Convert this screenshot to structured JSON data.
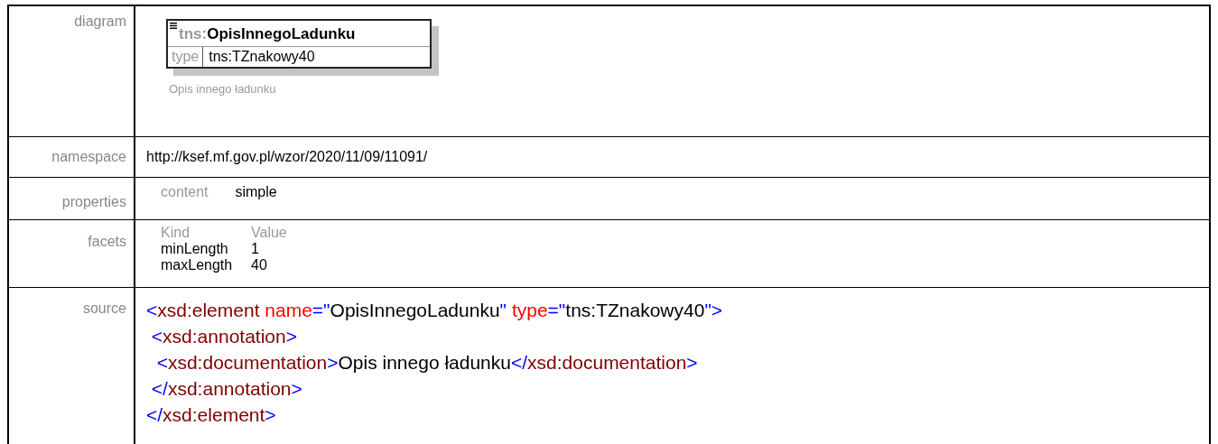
{
  "rows": [
    {
      "kind": "diagram",
      "label": "diagram",
      "diagram": {
        "prefix": "tns:",
        "name": "OpisInnegoLadunku",
        "type_label": "type",
        "type_value": "tns:TZnakowy40",
        "documentation": "Opis innego ładunku"
      }
    },
    {
      "kind": "text",
      "label": "namespace",
      "value": "http://ksef.mf.gov.pl/wzor/2020/11/09/11091/"
    },
    {
      "kind": "properties",
      "label": "properties",
      "items": [
        {
          "name": "content",
          "value": "simple"
        }
      ]
    },
    {
      "kind": "facets",
      "label": "facets",
      "columns": [
        "Kind",
        "Value"
      ],
      "items": [
        {
          "name": "minLength",
          "value": "1"
        },
        {
          "name": "maxLength",
          "value": "40"
        }
      ]
    },
    {
      "kind": "source",
      "label": "source",
      "lines": [
        [
          {
            "kind": "punct",
            "text": "<"
          },
          {
            "kind": "tag",
            "text": "xsd:element "
          },
          {
            "kind": "attr",
            "text": "name"
          },
          {
            "kind": "punct",
            "text": "=\""
          },
          {
            "kind": "text",
            "text": "OpisInnegoLadunku"
          },
          {
            "kind": "punct",
            "text": "\" "
          },
          {
            "kind": "attr",
            "text": "type"
          },
          {
            "kind": "punct",
            "text": "=\""
          },
          {
            "kind": "text",
            "text": "tns:TZnakowy40"
          },
          {
            "kind": "punct",
            "text": "\">"
          }
        ],
        [
          {
            "kind": "punct",
            "text": " <"
          },
          {
            "kind": "tag",
            "text": "xsd:annotation"
          },
          {
            "kind": "punct",
            "text": ">"
          }
        ],
        [
          {
            "kind": "punct",
            "text": "  <"
          },
          {
            "kind": "tag",
            "text": "xsd:documentation"
          },
          {
            "kind": "punct",
            "text": ">"
          },
          {
            "kind": "text",
            "text": "Opis innego ładunku"
          },
          {
            "kind": "punct",
            "text": "</"
          },
          {
            "kind": "tag",
            "text": "xsd:documentation"
          },
          {
            "kind": "punct",
            "text": ">"
          }
        ],
        [
          {
            "kind": "punct",
            "text": " </"
          },
          {
            "kind": "tag",
            "text": "xsd:annotation"
          },
          {
            "kind": "punct",
            "text": ">"
          }
        ],
        [
          {
            "kind": "punct",
            "text": "</"
          },
          {
            "kind": "tag",
            "text": "xsd:element"
          },
          {
            "kind": "punct",
            "text": ">"
          }
        ]
      ]
    }
  ]
}
